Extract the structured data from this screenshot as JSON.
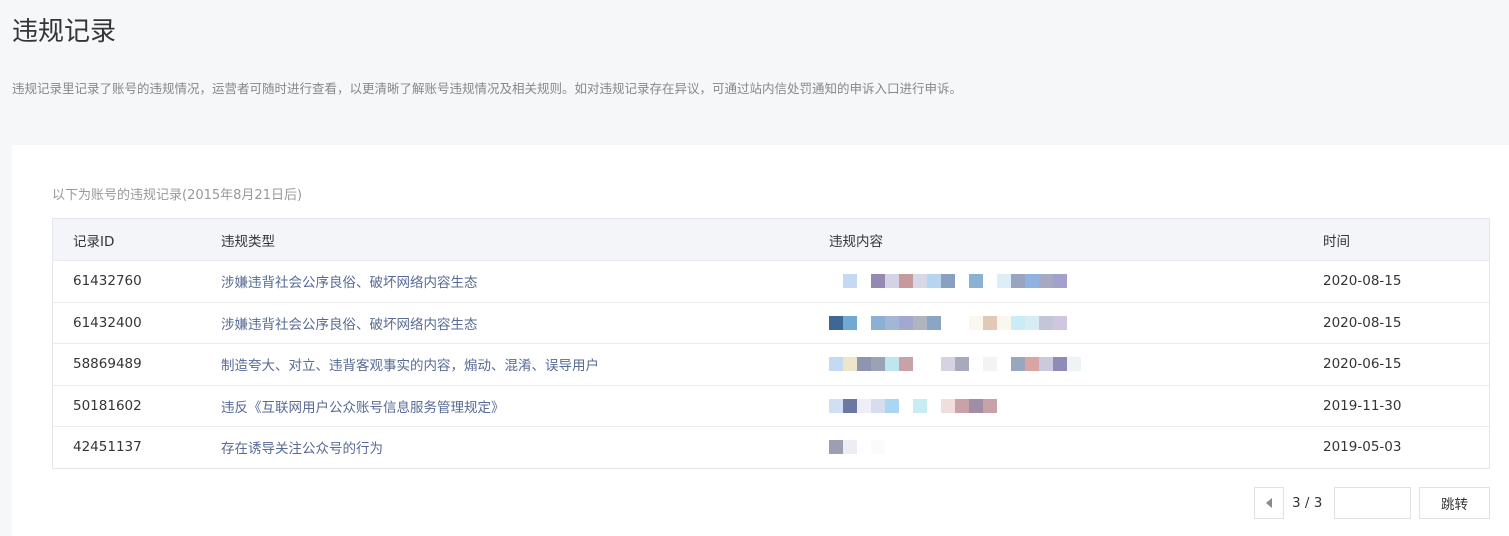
{
  "page": {
    "title": "违规记录",
    "description": "违规记录里记录了账号的违规情况，运营者可随时进行查看，以更清晰了解账号违规情况及相关规则。如对违规记录存在异议，可通过站内信处罚通知的申诉入口进行申诉。"
  },
  "table": {
    "caption": "以下为账号的违规记录(2015年8月21日后)",
    "columns": {
      "id": "记录ID",
      "type": "违规类型",
      "content": "违规内容",
      "time": "时间"
    },
    "rows": [
      {
        "id": "61432760",
        "type": "涉嫌违背社会公序良俗、破坏网络内容生态",
        "time": "2020-08-15",
        "content_blur": [
          "#ffffff",
          "#c4daf2",
          "#ffffff",
          "#9489b2",
          "#d6d2e6",
          "#c8999c",
          "#d6d8e6",
          "#b5d6ee",
          "#8aa0c0",
          "#ffffff",
          "#8ab2d4",
          "#ffffff",
          "#ddeef6",
          "#9aa4c0",
          "#8fb2de",
          "#a7a8c2",
          "#a4a0cc"
        ]
      },
      {
        "id": "61432400",
        "type": "涉嫌违背社会公序良俗、破坏网络内容生态",
        "time": "2020-08-15",
        "content_blur": [
          "#3f6796",
          "#6fa9d4",
          "#ffffff",
          "#8cafd6",
          "#a3b6d6",
          "#a3a8d0",
          "#b0b4be",
          "#8aa6c4",
          "#ffffff",
          "#ffffff",
          "#fbf6ee",
          "#e2c9b6",
          "#fbf6ee",
          "#c9ecf6",
          "#d8ecf6",
          "#c3c6d6",
          "#d2c6de"
        ]
      },
      {
        "id": "58869489",
        "type": "制造夸大、对立、违背客观事实的内容，煽动、混淆、误导用户",
        "time": "2020-06-15",
        "content_blur": [
          "#c4daf2",
          "#eee6c8",
          "#8f94b2",
          "#9aa2b6",
          "#bde6ee",
          "#c8a2a8",
          "#ffffff",
          "#ffffff",
          "#d6d2e2",
          "#a7aabd",
          "#ffffff",
          "#f3f3f6",
          "#ffffff",
          "#98a6be",
          "#d9a4a3",
          "#cbc9dc",
          "#8f8bb6",
          "#eef4f6"
        ]
      },
      {
        "id": "50181602",
        "type": "违反《互联网用户公众账号信息服务管理规定》",
        "time": "2019-11-30",
        "content_blur": [
          "#d0e0f2",
          "#6c78a2",
          "#eeeef6",
          "#d8dcee",
          "#a9d6f2",
          "#ffffff",
          "#c6eef2",
          "#ffffff",
          "#f0dede",
          "#c8a2a6",
          "#9f8ea6",
          "#c6a2aa"
        ]
      },
      {
        "id": "42451137",
        "type": "存在诱导关注公众号的行为",
        "time": "2019-05-03",
        "content_blur": [
          "#9e9eb2",
          "#eceef4",
          "#ffffff",
          "#fbfbfc"
        ]
      }
    ]
  },
  "pagination": {
    "page_text": "3 / 3",
    "input_value": "",
    "jump_label": "跳转",
    "prev_icon": "triangle-left-icon"
  }
}
